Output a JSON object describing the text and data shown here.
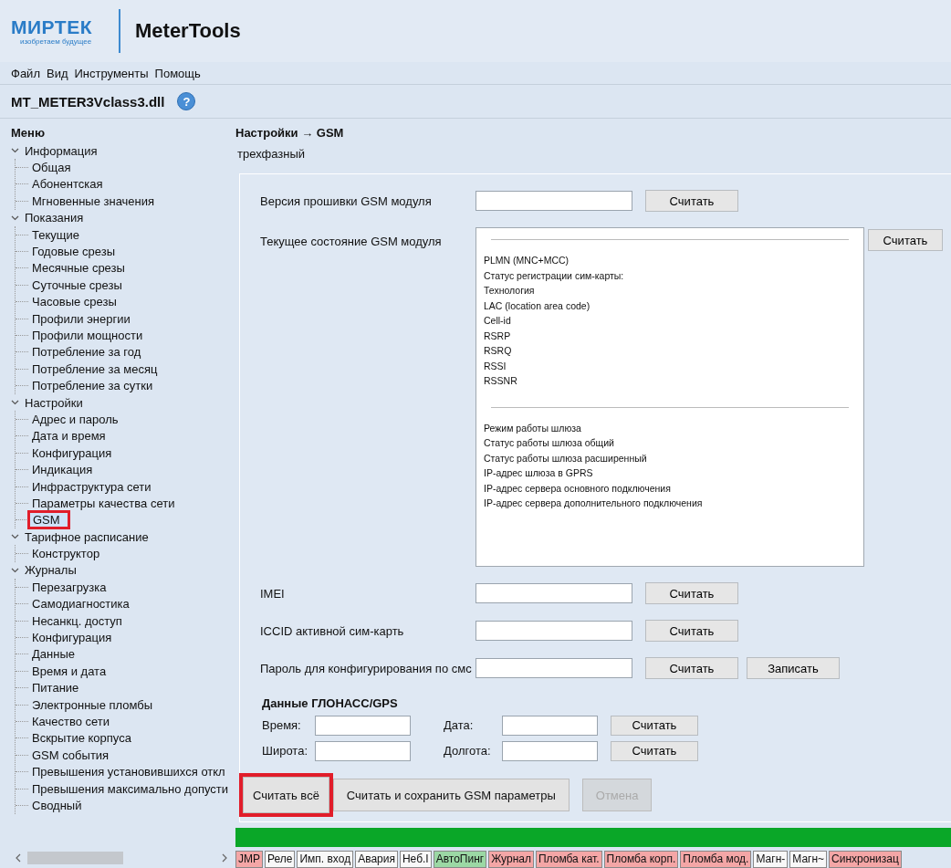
{
  "app": {
    "logo": "МИРТЕК",
    "logo_tagline": "изобретаем будущее",
    "title": "MeterTools"
  },
  "menu_bar": [
    "Файл",
    "Вид",
    "Инструменты",
    "Помощь"
  ],
  "module": {
    "name": "MT_METER3Vclass3.dll",
    "help": "?"
  },
  "sidebar": {
    "title": "Меню",
    "items": [
      {
        "label": "Информация",
        "expanded": true,
        "children": [
          {
            "label": "Общая",
            "selected": false
          },
          {
            "label": "Абонентская",
            "selected": false
          },
          {
            "label": "Мгновенные значения",
            "selected": false
          }
        ]
      },
      {
        "label": "Показания",
        "expanded": true,
        "children": [
          {
            "label": "Текущие",
            "selected": false
          },
          {
            "label": "Годовые срезы",
            "selected": false
          },
          {
            "label": "Месячные срезы",
            "selected": false
          },
          {
            "label": "Суточные срезы",
            "selected": false
          },
          {
            "label": "Часовые срезы",
            "selected": false
          },
          {
            "label": "Профили энергии",
            "selected": false
          },
          {
            "label": "Профили мощности",
            "selected": false
          },
          {
            "label": "Потребление за год",
            "selected": false
          },
          {
            "label": "Потребление за месяц",
            "selected": false
          },
          {
            "label": "Потребление за сутки",
            "selected": false
          }
        ]
      },
      {
        "label": "Настройки",
        "expanded": true,
        "children": [
          {
            "label": "Адрес и пароль",
            "selected": false
          },
          {
            "label": "Дата и время",
            "selected": false
          },
          {
            "label": "Конфигурация",
            "selected": false
          },
          {
            "label": "Индикация",
            "selected": false
          },
          {
            "label": "Инфраструктура сети",
            "selected": false
          },
          {
            "label": "Параметры качества сети",
            "selected": false
          },
          {
            "label": "GSM",
            "selected": true
          }
        ]
      },
      {
        "label": "Тарифное расписание",
        "expanded": true,
        "children": [
          {
            "label": "Конструктор",
            "selected": false
          }
        ]
      },
      {
        "label": "Журналы",
        "expanded": true,
        "children": [
          {
            "label": "Перезагрузка",
            "selected": false
          },
          {
            "label": "Самодиагностика",
            "selected": false
          },
          {
            "label": "Несанкц. доступ",
            "selected": false
          },
          {
            "label": "Конфигурация",
            "selected": false
          },
          {
            "label": "Данные",
            "selected": false
          },
          {
            "label": "Время и дата",
            "selected": false
          },
          {
            "label": "Питание",
            "selected": false
          },
          {
            "label": "Электронные пломбы",
            "selected": false
          },
          {
            "label": "Качество сети",
            "selected": false
          },
          {
            "label": "Вскрытие корпуса",
            "selected": false
          },
          {
            "label": "GSM события",
            "selected": false
          },
          {
            "label": "Превышения установившихся откл",
            "selected": false
          },
          {
            "label": "Превышения максимально допусти",
            "selected": false
          },
          {
            "label": "Сводный",
            "selected": false
          }
        ]
      }
    ]
  },
  "content": {
    "breadcrumb": "Настройки → GSM",
    "subtitle": "трехфазный",
    "rows": [
      {
        "kind": "field",
        "label": "Версия прошивки GSM модуля",
        "buttons": [
          "Считать"
        ]
      },
      {
        "kind": "list",
        "label": "Текущее состояние GSM модуля",
        "groups": [
          [
            "PLMN (MNC+MCC)",
            "Статус регистрации сим-карты:",
            "Технология",
            "LAC (location area code)",
            "Cell-id",
            "RSRP",
            "RSRQ",
            "RSSI",
            "RSSNR"
          ],
          [
            "Режим работы шлюза",
            "Статус работы шлюза общий",
            "Статус работы шлюза расширенный",
            "IP-адрес шлюза в GPRS",
            "IP-адрес сервера основного подключения",
            "IP-адрес сервера дополнительного подключения"
          ]
        ],
        "buttons": [
          "Считать"
        ]
      },
      {
        "kind": "field",
        "label": "IMEI",
        "buttons": [
          "Считать"
        ]
      },
      {
        "kind": "field",
        "label": "ICCID активной сим-карть",
        "buttons": [
          "Считать"
        ]
      },
      {
        "kind": "field",
        "label": "Пароль для конфигурирования по смс",
        "buttons": [
          "Считать",
          "Записать"
        ]
      }
    ],
    "gps": {
      "title": "Данные ГЛОНАСС/GPS",
      "rows": [
        {
          "fields": [
            "Время:",
            "Дата:"
          ],
          "button": "Считать"
        },
        {
          "fields": [
            "Широта:",
            "Долгота:"
          ],
          "button": "Считать"
        }
      ]
    },
    "actions": [
      {
        "label": "Считать всё",
        "outlined": true,
        "disabled": false
      },
      {
        "label": "Считать и сохранить GSM параметры",
        "outlined": false,
        "disabled": false
      },
      {
        "label": "Отмена",
        "outlined": false,
        "disabled": true
      }
    ]
  },
  "progress": {
    "level": 1
  },
  "status_tags": [
    {
      "label": "JMP",
      "color": "#f4a6a6"
    },
    {
      "label": "Реле",
      "color": "#f8f8f8"
    },
    {
      "label": "Имп. вход",
      "color": "#f8f8f8"
    },
    {
      "label": "Авария",
      "color": "#f8f8f8"
    },
    {
      "label": "Неб.I",
      "color": "#f8f8f8"
    },
    {
      "label": "АвтоПинг",
      "color": "#9bd8a4"
    },
    {
      "label": "Журнал",
      "color": "#f4a6a6"
    },
    {
      "label": "Пломба кат.",
      "color": "#f4a6a6"
    },
    {
      "label": "Пломба корп.",
      "color": "#f4a6a6"
    },
    {
      "label": "Пломба мод.",
      "color": "#f4a6a6"
    },
    {
      "label": "Магн-",
      "color": "#f8f8f8"
    },
    {
      "label": "Магн~",
      "color": "#f8f8f8"
    },
    {
      "label": "Синхронизац",
      "color": "#f4a6a6"
    }
  ]
}
